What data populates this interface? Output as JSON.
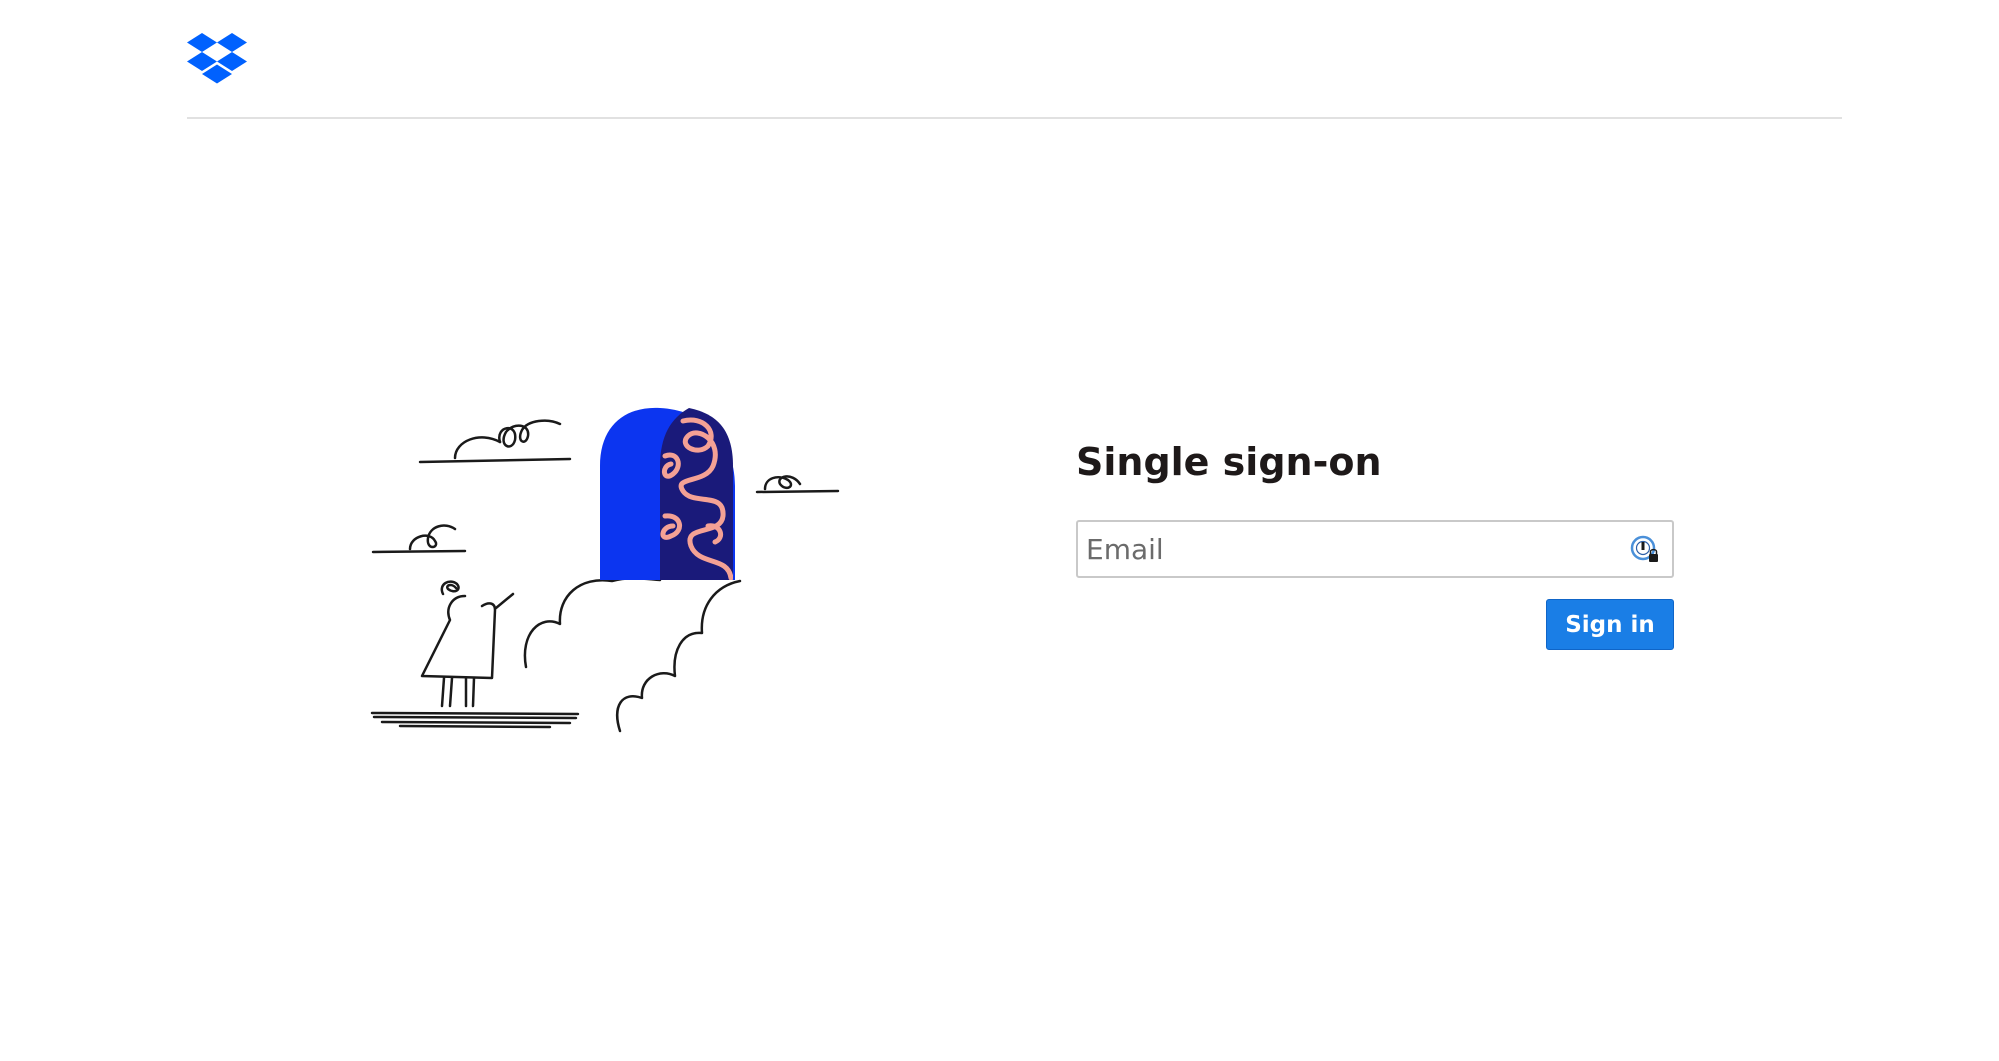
{
  "header": {
    "logo_icon": "dropbox-logo-icon",
    "brand_color": "#0061fe"
  },
  "illustration": {
    "subject": "person-facing-doorway-illustration",
    "door_blue": "#0c35f0",
    "pattern_navy": "#1a1a7a",
    "pattern_pink": "#f4a195"
  },
  "login": {
    "title": "Single sign-on",
    "email_placeholder": "Email",
    "email_value": "",
    "password_manager_icon": "password-manager-icon",
    "signin_label": "Sign in",
    "button_color": "#1a7ee6"
  }
}
